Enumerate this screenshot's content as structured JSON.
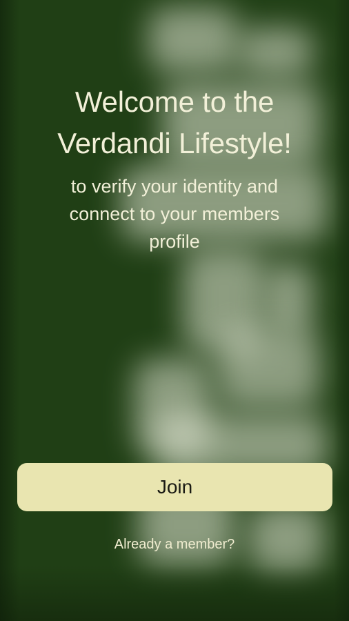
{
  "welcome": {
    "title_lines": [
      "Welcome to the",
      "Verdandi Lifestyle!"
    ],
    "subtitle_lines": [
      "to verify your identity and",
      "connect to your members",
      "profile"
    ]
  },
  "actions": {
    "join_label": "Join",
    "member_link_label": "Already a member?"
  },
  "colors": {
    "background": "#203f15",
    "text": "#f2f0d8",
    "button_bg": "#e9e5b0",
    "button_text": "#1b1b14"
  }
}
